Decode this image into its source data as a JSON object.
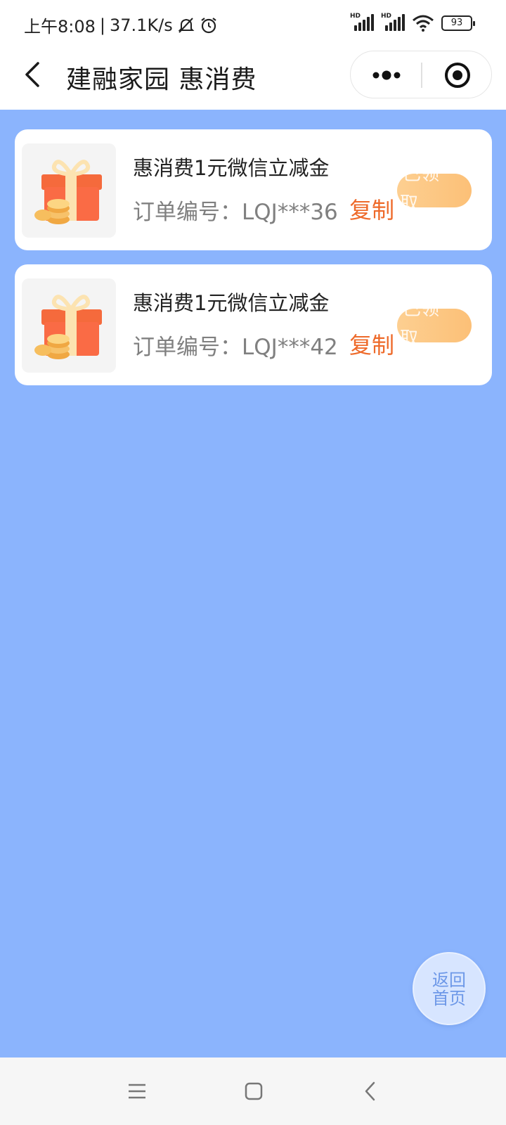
{
  "status_bar": {
    "time": "上午8:08",
    "separator": "|",
    "net_speed": "37.1K/s",
    "battery": "93",
    "signal_labels": [
      "HD",
      "HD"
    ]
  },
  "nav": {
    "title": "建融家园 惠消费"
  },
  "orders": [
    {
      "title": "惠消费1元微信立减金",
      "order_label": "订单编号：",
      "order_no": "LQJ***36",
      "copy_label": "复制",
      "button_text_1": "已领",
      "button_text_2": "取"
    },
    {
      "title": "惠消费1元微信立减金",
      "order_label": "订单编号：",
      "order_no": "LQJ***42",
      "copy_label": "复制",
      "button_text_1": "已领",
      "button_text_2": "取"
    }
  ],
  "float_button": {
    "line1": "返回",
    "line2": "首页"
  },
  "colors": {
    "background": "#8bb4fd",
    "accent": "#ee6a2a",
    "button": "#fcc077"
  }
}
